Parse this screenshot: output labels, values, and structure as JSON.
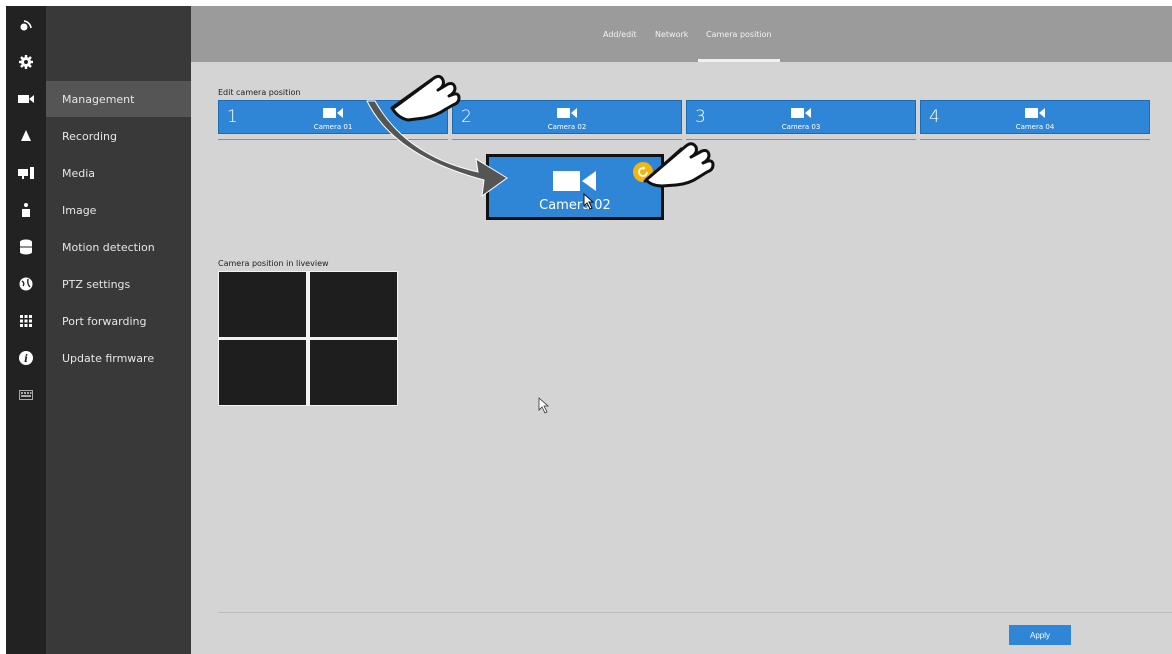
{
  "rail": {
    "icons": [
      "eye-icon",
      "gear-icon",
      "camera-icon",
      "bell-icon",
      "monitor-icon",
      "person-icon",
      "database-icon",
      "globe-icon",
      "grid-icon",
      "info-icon",
      "keyboard-icon"
    ]
  },
  "sidebar": {
    "items": [
      {
        "label": "Management",
        "active": true
      },
      {
        "label": "Recording"
      },
      {
        "label": "Media"
      },
      {
        "label": "Image"
      },
      {
        "label": "Motion detection"
      },
      {
        "label": "PTZ settings"
      },
      {
        "label": "Port forwarding"
      },
      {
        "label": "Update firmware"
      }
    ]
  },
  "tabs": [
    {
      "label": "Add/edit"
    },
    {
      "label": "Network"
    },
    {
      "label": "Camera position",
      "active": true
    }
  ],
  "edit_section": {
    "title": "Edit camera position",
    "tiles": [
      {
        "number": "1",
        "name": "Camera 01"
      },
      {
        "number": "2",
        "name": "Camera 02"
      },
      {
        "number": "3",
        "name": "Camera 03"
      },
      {
        "number": "4",
        "name": "Camera 04"
      }
    ],
    "dragged_tile": {
      "name": "Camera 02"
    }
  },
  "liveview_section": {
    "title": "Camera position in liveview"
  },
  "footer": {
    "apply_label": "Apply"
  },
  "colors": {
    "accent": "#2f86d6",
    "badge": "#f3b50e",
    "sidebar": "#393939",
    "rail": "#222222"
  }
}
